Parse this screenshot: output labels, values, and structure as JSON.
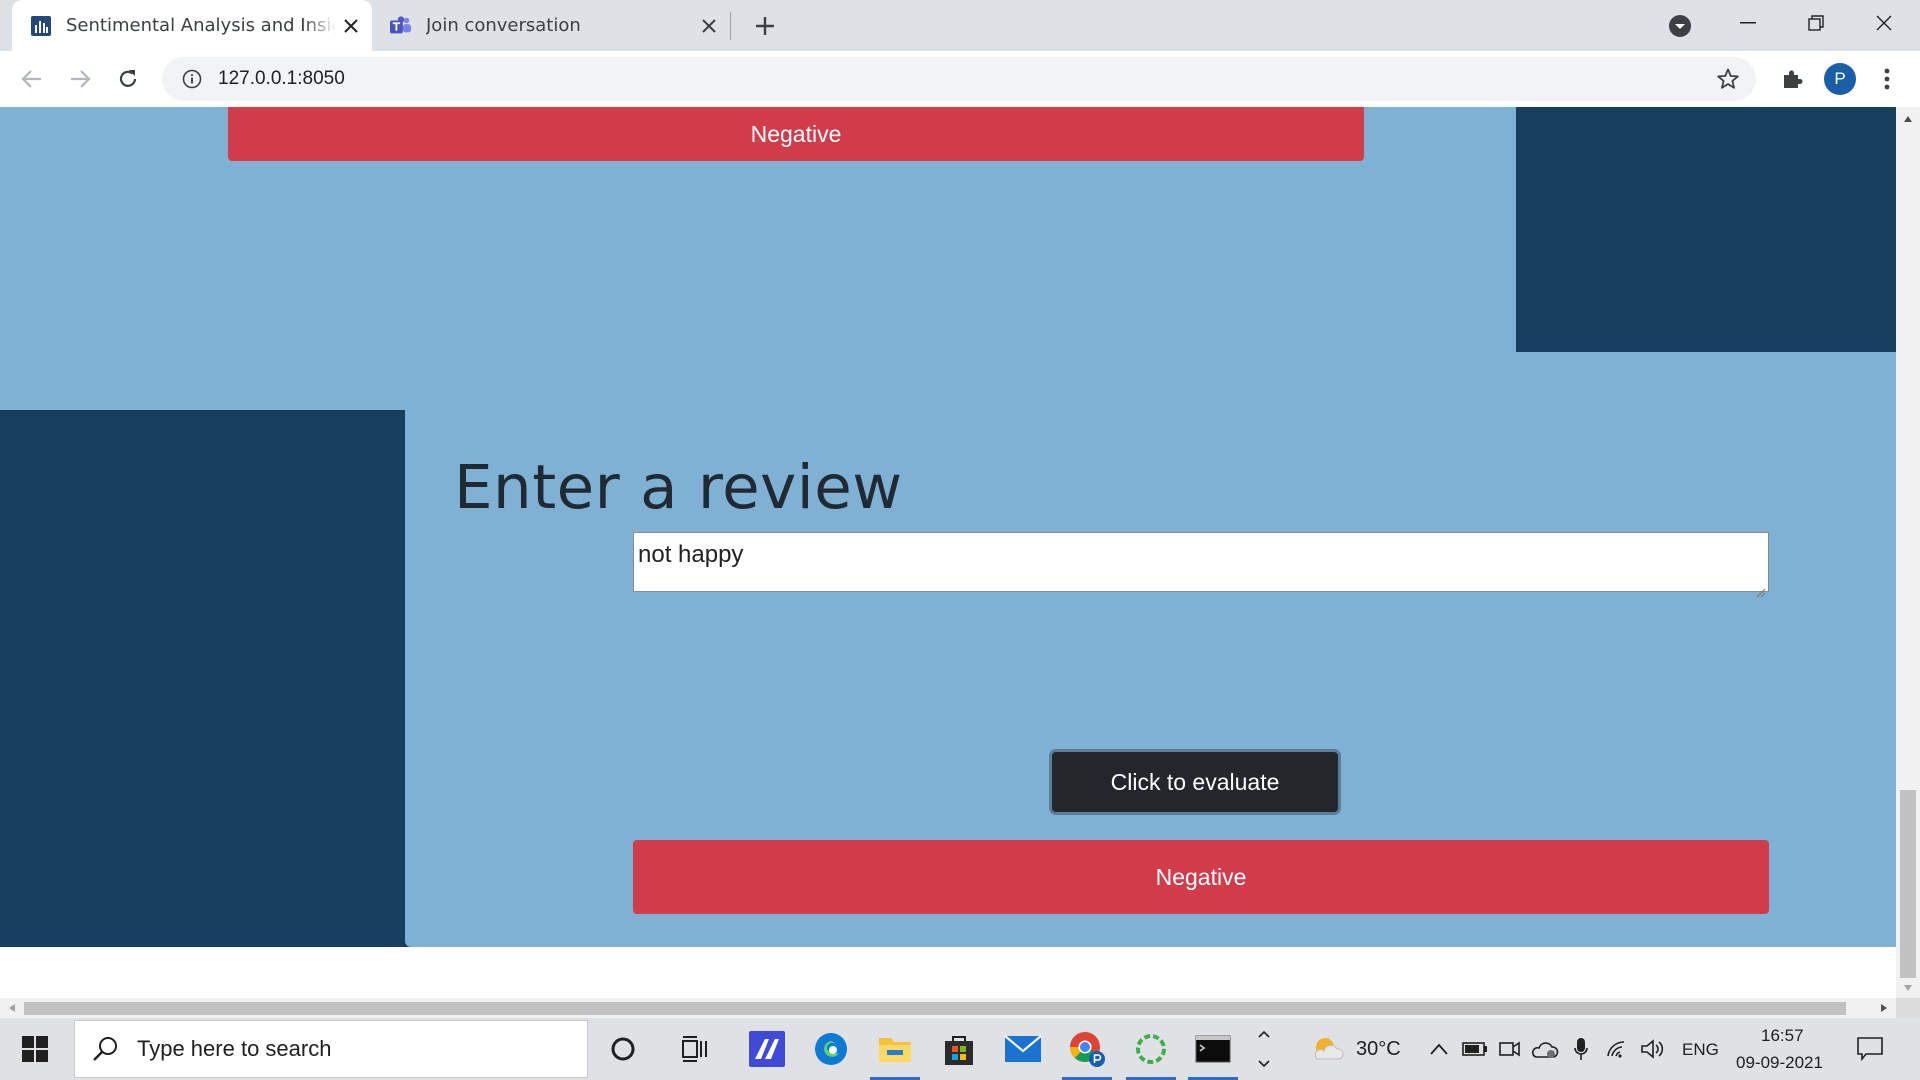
{
  "browser": {
    "tabs": [
      {
        "title": "Sentimental Analysis and Insights"
      },
      {
        "title": "Join conversation"
      }
    ],
    "url": "127.0.0.1:8050",
    "profile_initial": "P"
  },
  "page": {
    "top_result_label": "Negative",
    "heading": "Enter a review",
    "review_value": "not happy",
    "evaluate_button_label": "Click to evaluate",
    "result_label": "Negative",
    "colors": {
      "page_background": "#17405e",
      "card_background": "#7fb1d5",
      "negative": "#d13c4b",
      "button_dark": "#23272b"
    }
  },
  "taskbar": {
    "search_placeholder": "Type here to search",
    "weather": "30°C",
    "language": "ENG",
    "time": "16:57",
    "date": "09-09-2021"
  }
}
